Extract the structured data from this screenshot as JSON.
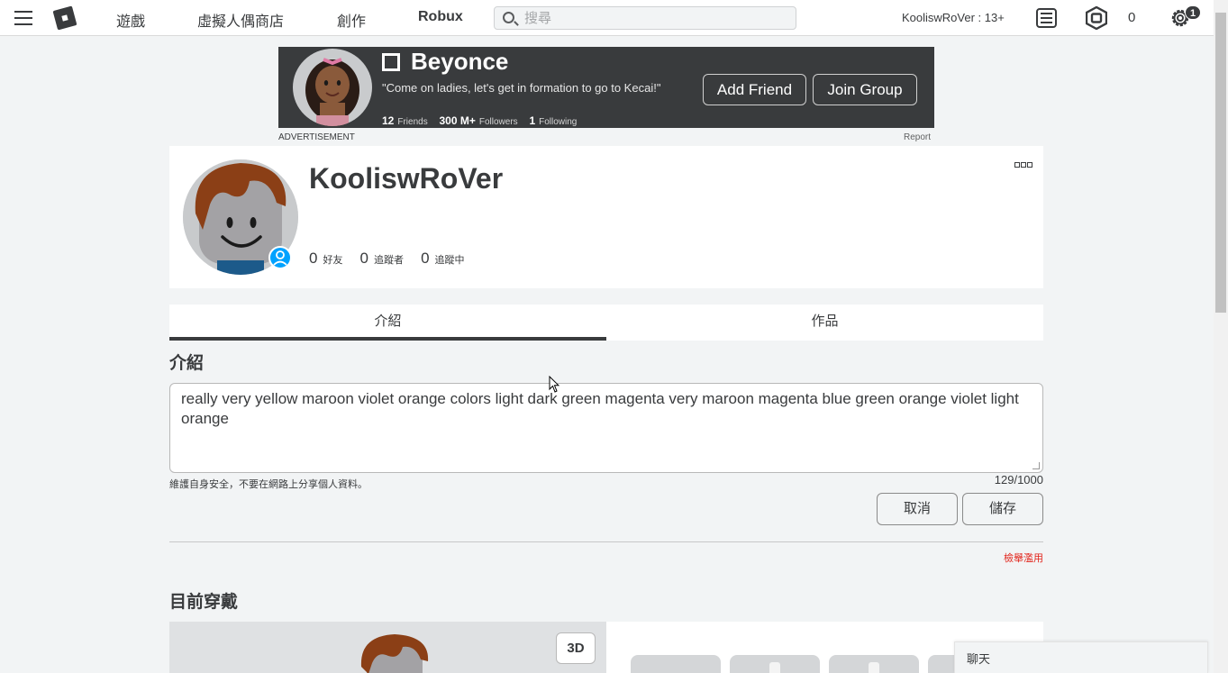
{
  "nav": {
    "links": [
      "遊戲",
      "虛擬人偶商店",
      "創作",
      "Robux"
    ],
    "search_placeholder": "搜尋",
    "username": "KooliswRoVer : 13+",
    "robux_count": "0",
    "notification_count": "1",
    "icons": [
      "menu-icon",
      "roblox-logo-icon",
      "search-icon",
      "messages-icon",
      "robux-icon",
      "gear-icon"
    ]
  },
  "ad": {
    "name": "Beyonce",
    "quote": "\"Come on ladies, let's get in formation to go to Kecai!\"",
    "friends_count": "12",
    "friends_label": "Friends",
    "followers_count": "300 M+",
    "followers_label": "Followers",
    "following_count": "1",
    "following_label": "Following",
    "add_friend": "Add Friend",
    "join_group": "Join Group",
    "label": "ADVERTISEMENT",
    "report": "Report"
  },
  "profile": {
    "name": "KooliswRoVer",
    "friends_count": "0",
    "friends_label": "好友",
    "followers_count": "0",
    "followers_label": "追蹤者",
    "following_count": "0",
    "following_label": "追蹤中"
  },
  "tabs": [
    "介紹",
    "作品"
  ],
  "active_tab": "介紹",
  "about": {
    "title": "介紹",
    "text": "really very yellow maroon violet orange colors light dark green magenta very maroon magenta blue green orange violet light orange",
    "safety_note": "維護自身安全，不要在網路上分享個人資料。",
    "char_count": "129/1000",
    "cancel": "取消",
    "save": "儲存",
    "report_abuse": "檢舉濫用"
  },
  "wearing": {
    "title": "目前穿戴",
    "toggle_3d": "3D"
  },
  "chat": {
    "label": "聊天"
  },
  "colors": {
    "text": "#393b3d",
    "accent_blue": "#00a2ff",
    "ad_background": "#393b3d",
    "report_red": "#e2231a"
  }
}
